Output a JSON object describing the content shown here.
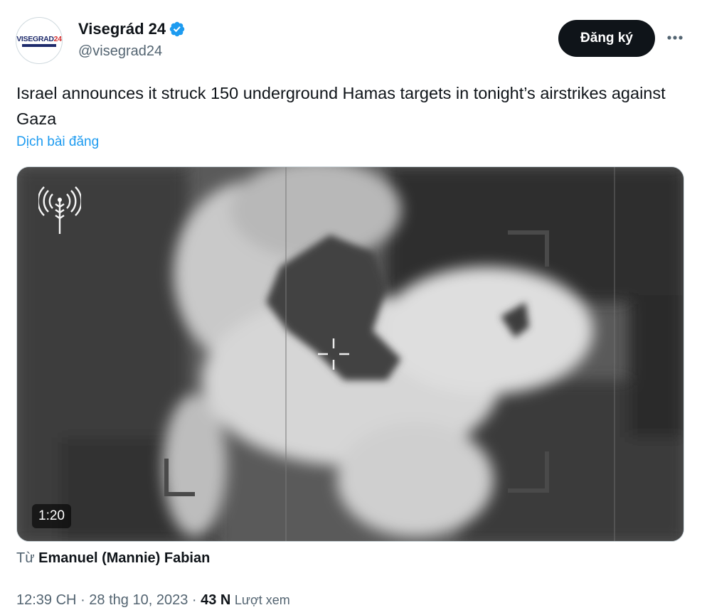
{
  "author": {
    "display_name": "Visegrád 24",
    "handle": "@visegrad24",
    "avatar_text": "VISEGRAD",
    "avatar_text_accent": "24",
    "verified_icon": "verified-badge-icon"
  },
  "actions": {
    "subscribe_label": "Đăng ký",
    "more_icon": "more-options-icon"
  },
  "tweet": {
    "text": "Israel announces it struck 150 underground Hamas targets in tonight’s airstrikes against Gaza",
    "translate_label": "Dịch bài đăng"
  },
  "media": {
    "type": "video",
    "duration": "1:20",
    "watermark_icon": "idf-antenna-logo-icon"
  },
  "source": {
    "prefix": "Từ",
    "author": "Emanuel (Mannie) Fabian"
  },
  "meta": {
    "time": "12:39 CH",
    "separator": "·",
    "date": "28 thg 10, 2023",
    "views_count": "43 N",
    "views_label": "Lượt xem"
  },
  "colors": {
    "accent": "#1d9bf0",
    "text_primary": "#0f1419",
    "text_secondary": "#536471",
    "button_bg": "#0f1419"
  }
}
